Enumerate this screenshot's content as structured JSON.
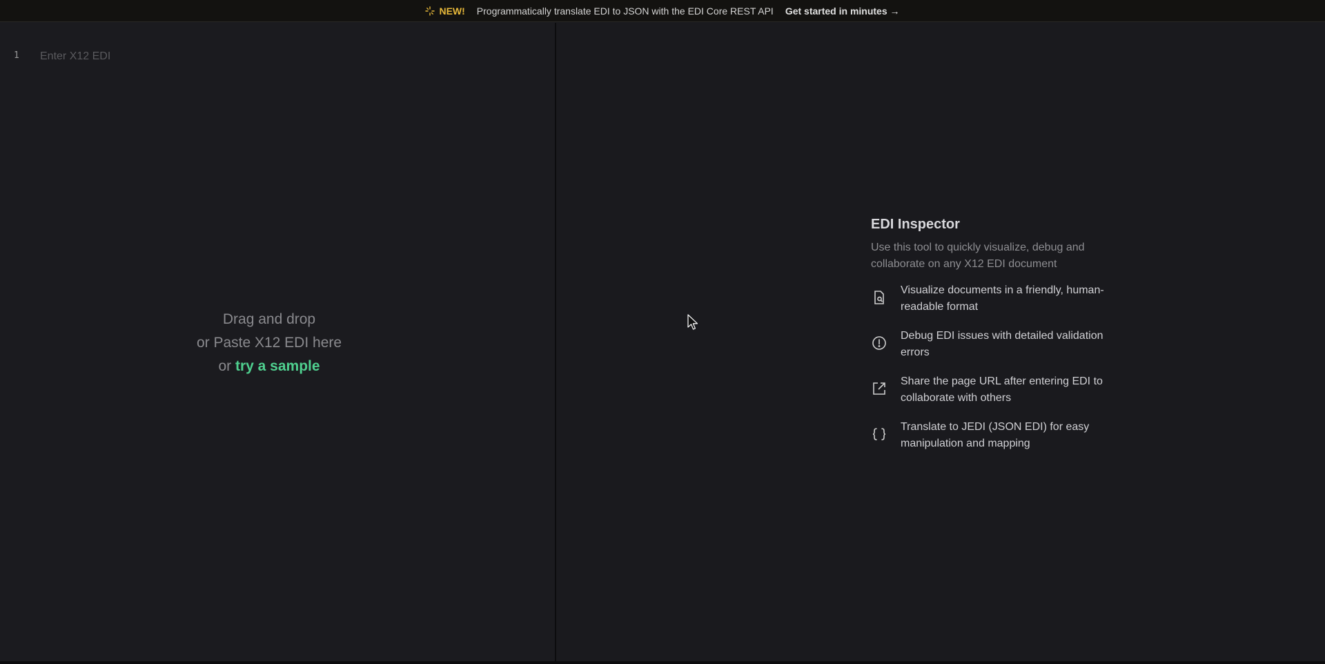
{
  "banner": {
    "new_label": "NEW!",
    "message": "Programmatically translate EDI to JSON with the EDI Core REST API",
    "cta": "Get started in minutes →"
  },
  "editor": {
    "line_number": "1",
    "placeholder": "Enter X12 EDI",
    "value": ""
  },
  "dropzone": {
    "line1": "Drag and drop",
    "line2": "or Paste X12 EDI here",
    "line3_prefix": "or",
    "sample_link": "try a sample"
  },
  "inspector": {
    "title": "EDI Inspector",
    "subtitle": "Use this tool to quickly visualize, debug and collaborate on any X12 EDI document",
    "features": [
      {
        "icon": "document-search-icon",
        "text": "Visualize documents in a friendly, human-readable format"
      },
      {
        "icon": "alert-circle-icon",
        "text": "Debug EDI issues with detailed validation errors"
      },
      {
        "icon": "external-link-icon",
        "text": "Share the page URL after entering EDI to collaborate with others"
      },
      {
        "icon": "braces-icon",
        "text": "Translate to JEDI (JSON EDI) for easy manipulation and mapping"
      }
    ]
  },
  "colors": {
    "accent_new": "#e8b93a",
    "accent_sample": "#4fd08f",
    "background": "#1a1a1e"
  }
}
